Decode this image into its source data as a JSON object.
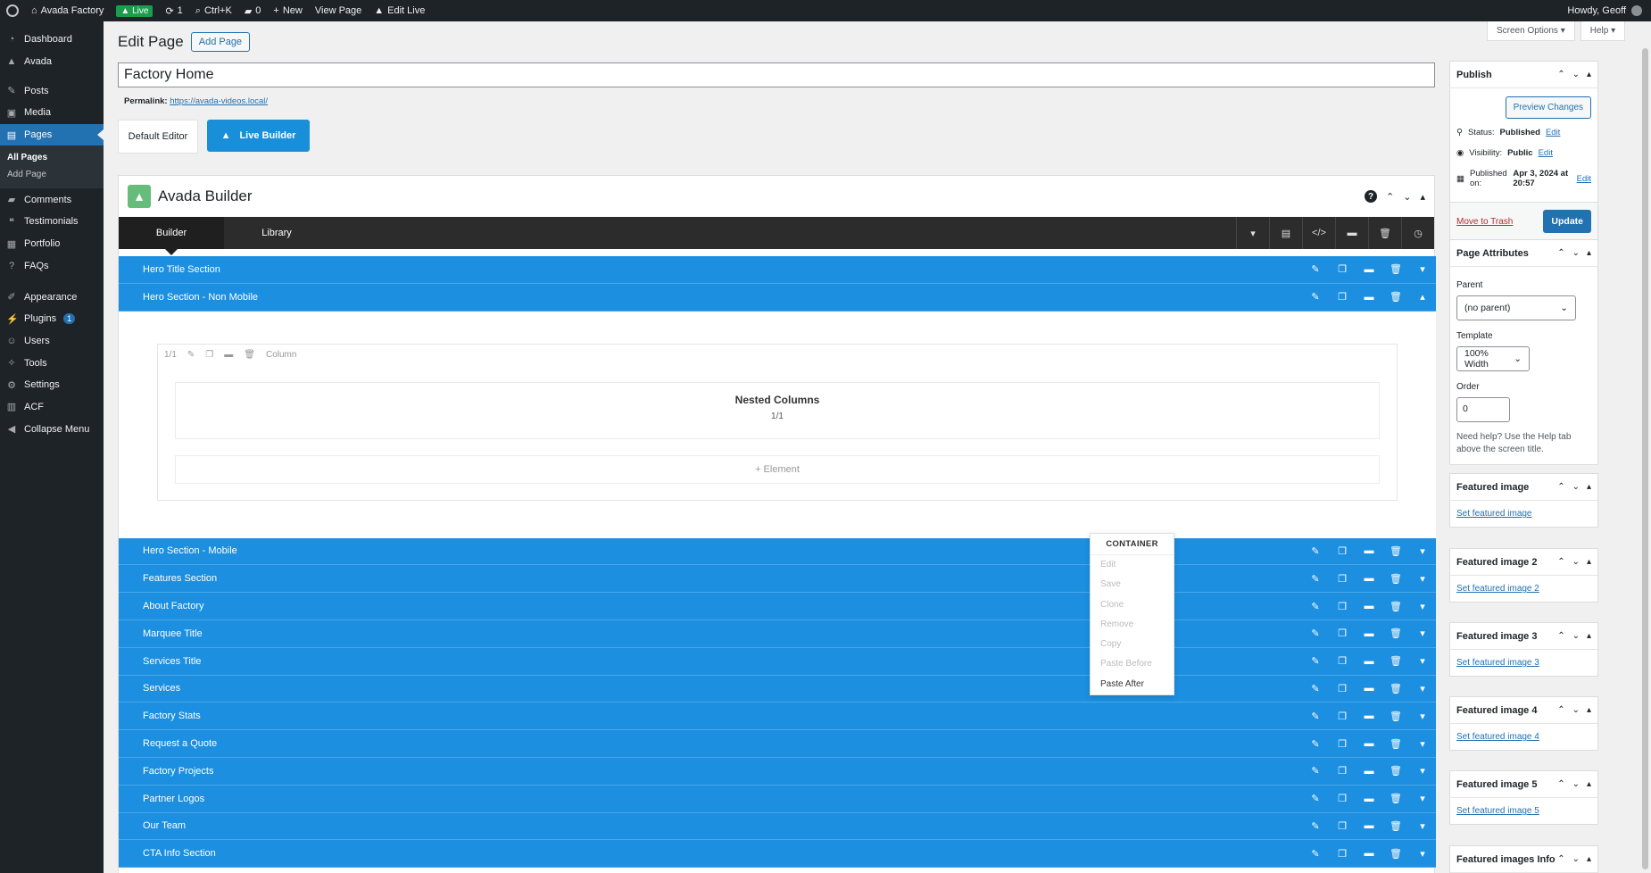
{
  "admin_bar": {
    "site_name": "Avada Factory",
    "live_label": "Live",
    "updates_count": "1",
    "search_shortcut": "Ctrl+K",
    "comments_count": "0",
    "new_label": "New",
    "view_page_label": "View Page",
    "edit_live_label": "Edit Live",
    "greeting": "Howdy, Geoff"
  },
  "sidebar": {
    "items": [
      {
        "label": "Dashboard",
        "icon": "dashboard-icon"
      },
      {
        "label": "Avada",
        "icon": "avada-icon"
      },
      {
        "label": "Posts",
        "icon": "pin-icon"
      },
      {
        "label": "Media",
        "icon": "media-icon"
      },
      {
        "label": "Pages",
        "icon": "pages-icon"
      },
      {
        "label": "Comments",
        "icon": "comment-icon"
      },
      {
        "label": "Testimonials",
        "icon": "testimonial-icon"
      },
      {
        "label": "Portfolio",
        "icon": "portfolio-icon"
      },
      {
        "label": "FAQs",
        "icon": "faq-icon"
      },
      {
        "label": "Appearance",
        "icon": "brush-icon"
      },
      {
        "label": "Plugins",
        "icon": "plugin-icon",
        "badge": "1"
      },
      {
        "label": "Users",
        "icon": "users-icon"
      },
      {
        "label": "Tools",
        "icon": "wrench-icon"
      },
      {
        "label": "Settings",
        "icon": "settings-icon"
      },
      {
        "label": "ACF",
        "icon": "acf-icon"
      },
      {
        "label": "Collapse Menu",
        "icon": "collapse-icon"
      }
    ],
    "pages_submenu": [
      "All Pages",
      "Add Page"
    ]
  },
  "header": {
    "title": "Edit Page",
    "add_page_button": "Add Page",
    "screen_options": "Screen Options ▾",
    "help": "Help ▾"
  },
  "post": {
    "title_value": "Factory Home",
    "permalink_label": "Permalink:",
    "permalink_url": "https://avada-videos.local/",
    "default_editor_button": "Default Editor",
    "live_builder_button": "Live Builder"
  },
  "builder": {
    "title": "Avada Builder",
    "tabs": [
      "Builder",
      "Library"
    ],
    "sections_top": [
      "Hero Title Section",
      "Hero Section - Non Mobile"
    ],
    "column": {
      "size": "1/1",
      "label": "Column",
      "nested_title": "Nested Columns",
      "nested_size": "1/1",
      "add_element": "+ Element"
    },
    "sections_bottom": [
      "Hero Section - Mobile",
      "Features Section",
      "About Factory",
      "Marquee Title",
      "Services Title",
      "Services",
      "Factory Stats",
      "Request a Quote",
      "Factory Projects",
      "Partner Logos",
      "Our Team",
      "CTA Info Section"
    ]
  },
  "context_menu": {
    "title": "CONTAINER",
    "items": [
      "Edit",
      "Save",
      "Clone",
      "Remove",
      "Copy",
      "Paste Before",
      "Paste After"
    ]
  },
  "publish": {
    "title": "Publish",
    "preview_button": "Preview Changes",
    "status_label": "Status:",
    "status_value": "Published",
    "visibility_label": "Visibility:",
    "visibility_value": "Public",
    "published_label": "Published on:",
    "published_value": "Apr 3, 2024 at 20:57",
    "edit_link": "Edit",
    "trash_link": "Move to Trash",
    "update_button": "Update"
  },
  "page_attributes": {
    "title": "Page Attributes",
    "parent_label": "Parent",
    "parent_value": "(no parent)",
    "template_label": "Template",
    "template_value": "100% Width",
    "order_label": "Order",
    "order_value": "0",
    "help_text": "Need help? Use the Help tab above the screen title."
  },
  "featured_images": [
    {
      "title": "Featured image",
      "link": "Set featured image"
    },
    {
      "title": "Featured image 2",
      "link": "Set featured image 2"
    },
    {
      "title": "Featured image 3",
      "link": "Set featured image 3"
    },
    {
      "title": "Featured image 4",
      "link": "Set featured image 4"
    },
    {
      "title": "Featured image 5",
      "link": "Set featured image 5"
    },
    {
      "title": "Featured images Info",
      "link": ""
    }
  ],
  "colors": {
    "section_blue": "#1c8fe0",
    "wp_admin_dark": "#1d2327",
    "accent": "#2271b1",
    "avada_green": "#65bc7b"
  }
}
